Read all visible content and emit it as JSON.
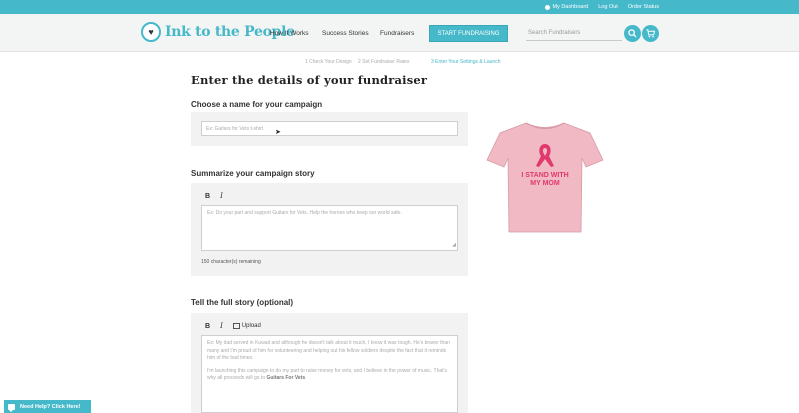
{
  "topbar": {
    "dashboard": "My Dashboard",
    "logout": "Log Out",
    "order_status": "Order Status"
  },
  "header": {
    "logo_text": "Ink to the People",
    "nav": [
      "How It Works",
      "Success Stories",
      "Fundraisers"
    ],
    "start_button": "START FUNDRAISING",
    "search_placeholder": "Search Fundraisers"
  },
  "steps": [
    "1 Check Your Design",
    "2 Set Fundraiser Rates",
    "3 Enter Your Settings & Launch"
  ],
  "page_title": "Enter the details of your fundraiser",
  "name_section": {
    "label": "Choose a name for your campaign",
    "placeholder": "Ex: Guitars for Vets t-shirt"
  },
  "summary_section": {
    "label": "Summarize your campaign story",
    "bold": "B",
    "italic": "I",
    "placeholder": "Ex: Do your part and support Guitars for Vets. Help the heroes who keep our world safe.",
    "remaining": "150 character(s) remaining"
  },
  "full_story_section": {
    "label": "Tell the full story (optional)",
    "bold": "B",
    "italic": "I",
    "upload": "Upload",
    "para1": "Ex: My dad served in Kuwait and although he doesn't talk about it much, I know it was tough. He's braver than many and I'm proud of him for volunteering and helping out his fellow soldiers despite the fact that it reminds him of the bad times.",
    "para2_prefix": "I'm launching this campaign to do my part to raise money for vets, and I believe in the power of music. That's why all proceeds will go to ",
    "para2_bold": "Guitars For Vets",
    "para2_suffix": "."
  },
  "shirt": {
    "line1": "I STAND WITH",
    "line2": "MY MOM",
    "shirt_color": "#f0b9c3",
    "ribbon_color": "#e0396d"
  },
  "help_button": "Need Help? Click Here!",
  "colors": {
    "accent": "#45b8c9"
  }
}
